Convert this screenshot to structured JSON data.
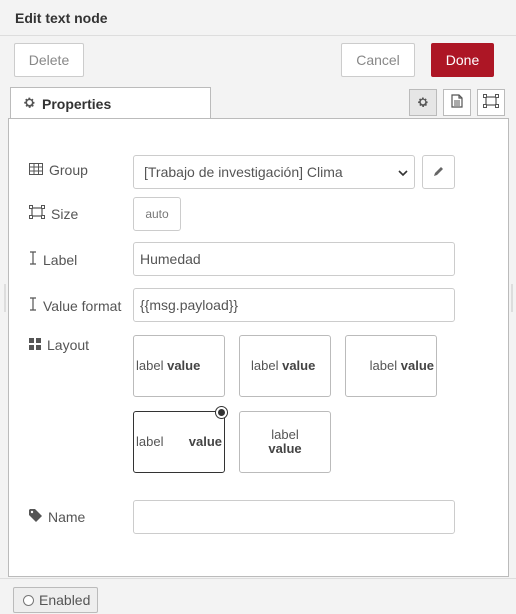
{
  "dialog": {
    "title": "Edit text node"
  },
  "toolbar": {
    "delete_label": "Delete",
    "cancel_label": "Cancel",
    "done_label": "Done",
    "done_color": "#ad1625"
  },
  "tabs": {
    "properties_label": "Properties"
  },
  "form": {
    "group": {
      "label": "Group",
      "value": "[Trabajo de investigación] Clima"
    },
    "size": {
      "label": "Size",
      "value": "auto"
    },
    "label_field": {
      "label": "Label",
      "value": "Humedad"
    },
    "value_format": {
      "label": "Value format",
      "value": "{{msg.payload}}"
    },
    "layout": {
      "label": "Layout",
      "options": [
        {
          "label": "label",
          "value": "value",
          "selected": false
        },
        {
          "label": "label",
          "value": "value",
          "selected": false
        },
        {
          "label": "label",
          "value": "value",
          "selected": false
        },
        {
          "label": "label",
          "value": "value",
          "selected": true
        },
        {
          "label": "label",
          "value": "value",
          "selected": false
        }
      ]
    },
    "name": {
      "label": "Name",
      "value": ""
    }
  },
  "footer": {
    "enabled_label": "Enabled"
  },
  "icons": [
    "gear-icon",
    "description-icon",
    "appearance-icon",
    "table-icon",
    "resize-icon",
    "text-cursor-icon",
    "grid-icon",
    "tag-icon",
    "pencil-icon",
    "chevron-down-icon",
    "circle-icon"
  ]
}
